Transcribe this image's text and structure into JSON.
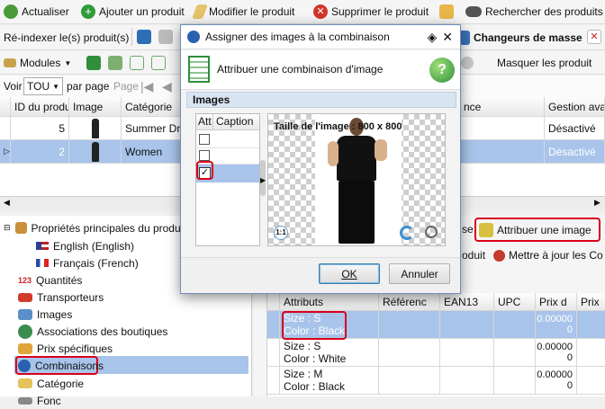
{
  "toolbar1": {
    "refresh": "Actualiser",
    "add_product": "Ajouter un produit",
    "edit_product": "Modifier le produit",
    "delete_product": "Supprimer le produit",
    "search_products": "Rechercher des produits"
  },
  "toolbar2": {
    "reindex": "Ré-indexer le(s) produit(s)",
    "mass_changers": "Changeurs de masse"
  },
  "toolbar3": {
    "modules": "Modules",
    "hide_products": "Masquer les produit"
  },
  "pager": {
    "see_label": "Voir",
    "count_value": "TOU",
    "per_page": "par page",
    "page_label": "Page"
  },
  "product_grid": {
    "columns": [
      "ID du produi",
      "Image",
      "Catégorie",
      "nce",
      "Gestion avan"
    ],
    "rows": [
      {
        "id": "5",
        "category": "Summer Dres",
        "advanced": "Désactivé"
      },
      {
        "id": "2",
        "category": "Women",
        "advanced": "Désactivé"
      }
    ]
  },
  "tree": {
    "root": "Propriétés principales du produit",
    "lang_en": "English (English)",
    "lang_fr": "Français (French)",
    "items": [
      "Quantités",
      "Transporteurs",
      "Images",
      "Associations des boutiques",
      "Prix spécifiques",
      "Combinaisons",
      "Catégorie",
      "Fonc"
    ]
  },
  "combo_panel": {
    "assign_image": "Attribuer une image",
    "produit_btn": "oduit",
    "update_btn": "Mettre à jour les Co",
    "se_label": "se",
    "columns": [
      "Attributs",
      "Référenc",
      "EAN13",
      "UPC",
      "Prix d",
      "Prix"
    ],
    "rows": [
      {
        "line1": "Size : S",
        "line2": "Color : Black",
        "price": "0.00000",
        "price2": "0"
      },
      {
        "line1": "Size : S",
        "line2": "Color : White",
        "price": "0.00000",
        "price2": "0"
      },
      {
        "line1": "Size : M",
        "line2": "Color : Black",
        "price": "0.00000",
        "price2": "0"
      }
    ]
  },
  "dialog": {
    "title": "Assigner des images à la combinaison",
    "subtitle": "Attribuer une combinaison d'image",
    "section": "Images",
    "col_att": "Att",
    "col_caption": "Caption",
    "image_size": "Taille de l'image : 800 x 800",
    "ok": "OK",
    "cancel": "Annuler",
    "zoom_badge": "1:1"
  },
  "colors": {
    "selection": "#a9c4ea",
    "highlight_outline": "#d9001b",
    "disabled_text": "#ffffff"
  }
}
